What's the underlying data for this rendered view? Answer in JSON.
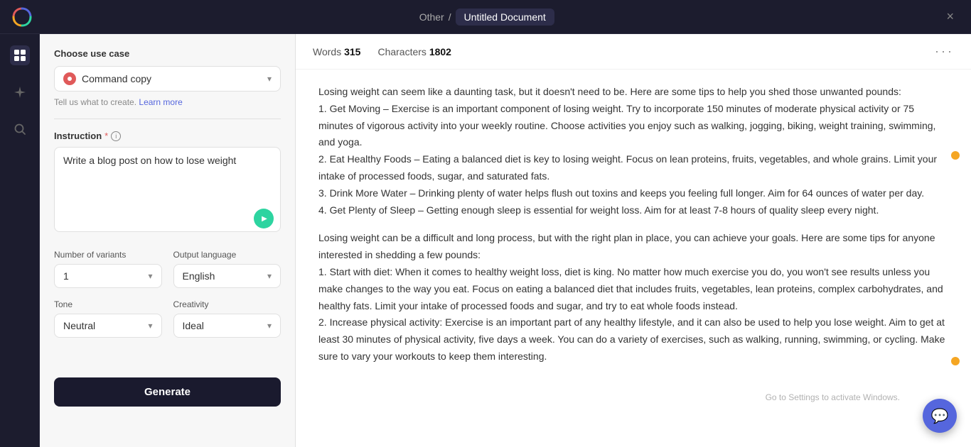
{
  "topbar": {
    "breadcrumb_other": "Other",
    "breadcrumb_separator": "/",
    "doc_title": "Untitled Document",
    "close_label": "×"
  },
  "left_panel": {
    "choose_use_case_label": "Choose use case",
    "use_case_value": "Command copy",
    "tell_us_text": "Tell us what to create.",
    "learn_more_text": "Learn more",
    "instruction_label": "Instruction",
    "instruction_required": "*",
    "instruction_placeholder": "Write a blog post on how to lose weight",
    "instruction_value": "Write a blog post on how to lose weight",
    "number_of_variants_label": "Number of variants",
    "number_of_variants_value": "1",
    "output_language_label": "Output language",
    "output_language_value": "English",
    "tone_label": "Tone",
    "tone_value": "Neutral",
    "creativity_label": "Creativity",
    "creativity_value": "Ideal",
    "generate_btn_label": "Generate"
  },
  "stats_bar": {
    "words_label": "Words",
    "words_count": "315",
    "characters_label": "Characters",
    "characters_count": "1802",
    "more_icon": "···"
  },
  "article": {
    "paragraphs": [
      "Losing weight can seem like a daunting task, but it doesn't need to be. Here are some tips to help you shed those unwanted pounds:\n1. Get Moving – Exercise is an important component of losing weight. Try to incorporate 150 minutes of moderate physical activity or 75 minutes of vigorous activity into your weekly routine. Choose activities you enjoy such as walking, jogging, biking, weight training, swimming, and yoga.\n2. Eat Healthy Foods – Eating a balanced diet is key to losing weight. Focus on lean proteins, fruits, vegetables, and whole grains. Limit your intake of processed foods, sugar, and saturated fats.\n3. Drink More Water – Drinking plenty of water helps flush out toxins and keeps you feeling full longer. Aim for 64 ounces of water per day.\n4. Get Plenty of Sleep – Getting enough sleep is essential for weight loss. Aim for at least 7-8 hours of quality sleep every night.",
      "Losing weight can be a difficult and long process, but with the right plan in place, you can achieve your goals. Here are some tips for anyone interested in shedding a few pounds:\n1. Start with diet: When it comes to healthy weight loss, diet is king. No matter how much exercise you do, you won't see results unless you make changes to the way you eat. Focus on eating a balanced diet that includes fruits, vegetables, lean proteins, complex carbohydrates, and healthy fats. Limit your intake of processed foods and sugar, and try to eat whole foods instead.\n2. Increase physical activity: Exercise is an important part of any healthy lifestyle, and it can also be used to help you lose weight. Aim to get at least 30 minutes of physical activity, five days a week. You can do a variety of exercises, such as walking, running, swimming, or cycling. Make sure to vary your workouts to keep them interesting."
    ]
  },
  "windows_watermark": "Go to Settings to activate Windows."
}
